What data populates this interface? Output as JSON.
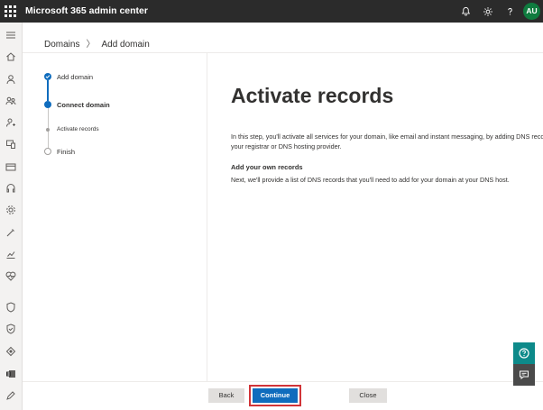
{
  "app": {
    "title": "Microsoft 365 admin center",
    "avatar_initials": "AU"
  },
  "icons": {
    "topbar": [
      "app-launcher-icon",
      "bell-icon",
      "gear-icon",
      "help-icon"
    ],
    "rail": [
      "hamburger-icon",
      "home-icon",
      "user-icon",
      "users-group-icon",
      "user-key-icon",
      "devices-icon",
      "billing-icon",
      "support-icon",
      "settings-icon",
      "setup-icon",
      "reports-icon",
      "health-icon",
      "security-icon",
      "compliance-icon",
      "endpoint-manager-icon",
      "exchange-icon",
      "pen-icon"
    ],
    "floating": [
      "help-circle-icon",
      "feedback-icon"
    ]
  },
  "breadcrumb": {
    "parent": "Domains",
    "separator": "〉",
    "current": "Add domain"
  },
  "steps": [
    {
      "label": "Add domain",
      "state": "done"
    },
    {
      "label": "Connect domain",
      "state": "current"
    },
    {
      "label": "Activate records",
      "state": "sub"
    },
    {
      "label": "Finish",
      "state": "pending"
    }
  ],
  "main": {
    "title": "Activate records",
    "description_line1": "In this step, you'll activate all services for your domain, like email and instant messaging, by adding DNS records at",
    "description_line2": "your registrar or DNS hosting provider.",
    "section_heading": "Add your own records",
    "section_text": "Next, we'll provide a list of DNS records that you'll need to add for your domain at your DNS host."
  },
  "footer": {
    "back_label": "Back",
    "continue_label": "Continue",
    "close_label": "Close"
  },
  "colors": {
    "topbar": "#2b2b2b",
    "accent": "#0f6cbd",
    "highlight": "#d13438",
    "avatar": "#0f7b3f",
    "help_float": "#0d8a8a"
  }
}
